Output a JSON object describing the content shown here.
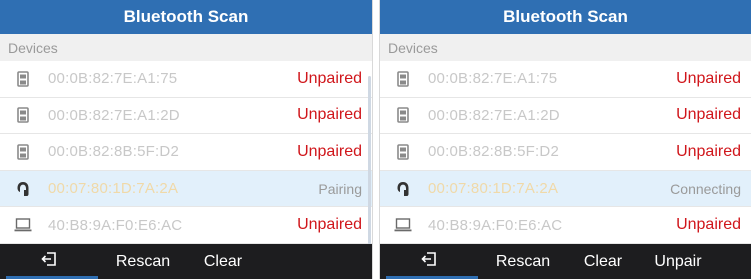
{
  "left": {
    "title": "Bluetooth Scan",
    "section": "Devices",
    "rows": [
      {
        "icon": "phone-icon",
        "address": "00:0B:82:7E:A1:75",
        "status": "Unpaired"
      },
      {
        "icon": "phone-icon",
        "address": "00:0B:82:7E:A1:2D",
        "status": "Unpaired"
      },
      {
        "icon": "phone-icon",
        "address": "00:0B:82:8B:5F:D2",
        "status": "Unpaired"
      },
      {
        "icon": "headset-icon",
        "address": "00:07:80:1D:7A:2A",
        "status": "Pairing"
      },
      {
        "icon": "laptop-icon",
        "address": "40:B8:9A:F0:E6:AC",
        "status": "Unpaired"
      }
    ],
    "softkeys": {
      "rescan": "Rescan",
      "clear": "Clear"
    }
  },
  "right": {
    "title": "Bluetooth Scan",
    "section": "Devices",
    "rows": [
      {
        "icon": "phone-icon",
        "address": "00:0B:82:7E:A1:75",
        "status": "Unpaired"
      },
      {
        "icon": "phone-icon",
        "address": "00:0B:82:7E:A1:2D",
        "status": "Unpaired"
      },
      {
        "icon": "phone-icon",
        "address": "00:0B:82:8B:5F:D2",
        "status": "Unpaired"
      },
      {
        "icon": "headset-icon",
        "address": "00:07:80:1D:7A:2A",
        "status": "Connecting"
      },
      {
        "icon": "laptop-icon",
        "address": "40:B8:9A:F0:E6:AC",
        "status": "Unpaired"
      }
    ],
    "softkeys": {
      "rescan": "Rescan",
      "clear": "Clear",
      "unpair": "Unpair"
    }
  },
  "colors": {
    "titlebar": "#2f6fb3",
    "unpaired": "#d0161b",
    "highlight": "#e2f0fb",
    "softkey_bar": "#1d1d1f"
  }
}
